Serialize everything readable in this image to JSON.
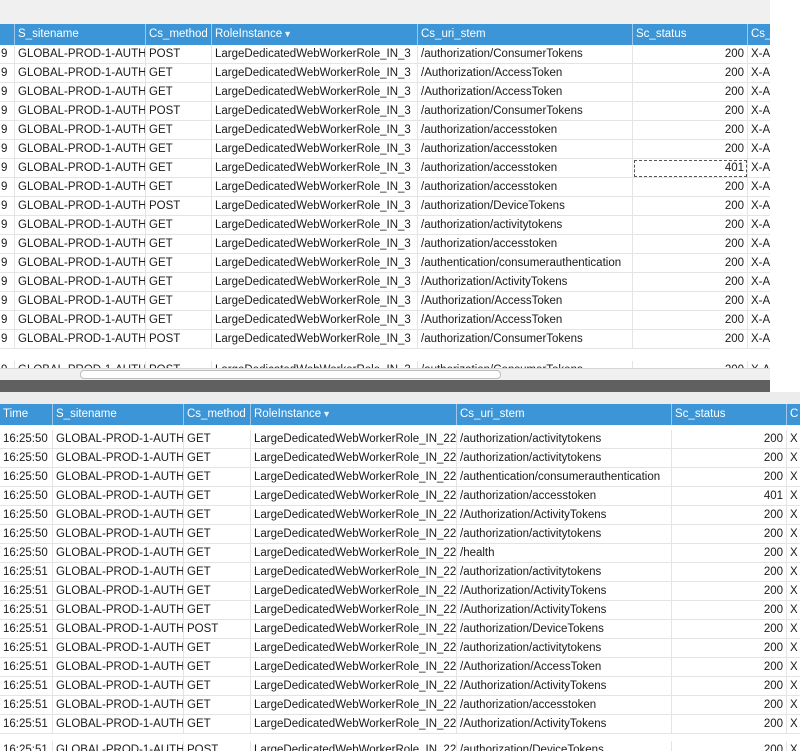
{
  "top_grid": {
    "columns": [
      "S_sitename",
      "Cs_method",
      "RoleInstance",
      "Cs_uri_stem",
      "Sc_status",
      "Cs_"
    ],
    "left_stub": "9",
    "right_stub": "X-A",
    "rows": [
      [
        "GLOBAL-PROD-1-AUTH",
        "POST",
        "LargeDedicatedWebWorkerRole_IN_3",
        "/authorization/ConsumerTokens",
        "200"
      ],
      [
        "GLOBAL-PROD-1-AUTH",
        "GET",
        "LargeDedicatedWebWorkerRole_IN_3",
        "/Authorization/AccessToken",
        "200"
      ],
      [
        "GLOBAL-PROD-1-AUTH",
        "GET",
        "LargeDedicatedWebWorkerRole_IN_3",
        "/Authorization/AccessToken",
        "200"
      ],
      [
        "GLOBAL-PROD-1-AUTH",
        "POST",
        "LargeDedicatedWebWorkerRole_IN_3",
        "/authorization/ConsumerTokens",
        "200"
      ],
      [
        "GLOBAL-PROD-1-AUTH",
        "GET",
        "LargeDedicatedWebWorkerRole_IN_3",
        "/authorization/accesstoken",
        "200"
      ],
      [
        "GLOBAL-PROD-1-AUTH",
        "GET",
        "LargeDedicatedWebWorkerRole_IN_3",
        "/authorization/accesstoken",
        "200"
      ],
      [
        "GLOBAL-PROD-1-AUTH",
        "GET",
        "LargeDedicatedWebWorkerRole_IN_3",
        "/authorization/accesstoken",
        "401"
      ],
      [
        "GLOBAL-PROD-1-AUTH",
        "GET",
        "LargeDedicatedWebWorkerRole_IN_3",
        "/authorization/accesstoken",
        "200"
      ],
      [
        "GLOBAL-PROD-1-AUTH",
        "POST",
        "LargeDedicatedWebWorkerRole_IN_3",
        "/authorization/DeviceTokens",
        "200"
      ],
      [
        "GLOBAL-PROD-1-AUTH",
        "GET",
        "LargeDedicatedWebWorkerRole_IN_3",
        "/authorization/activitytokens",
        "200"
      ],
      [
        "GLOBAL-PROD-1-AUTH",
        "GET",
        "LargeDedicatedWebWorkerRole_IN_3",
        "/authorization/accesstoken",
        "200"
      ],
      [
        "GLOBAL-PROD-1-AUTH",
        "GET",
        "LargeDedicatedWebWorkerRole_IN_3",
        "/authentication/consumerauthentication",
        "200"
      ],
      [
        "GLOBAL-PROD-1-AUTH",
        "GET",
        "LargeDedicatedWebWorkerRole_IN_3",
        "/Authorization/ActivityTokens",
        "200"
      ],
      [
        "GLOBAL-PROD-1-AUTH",
        "GET",
        "LargeDedicatedWebWorkerRole_IN_3",
        "/Authorization/AccessToken",
        "200"
      ],
      [
        "GLOBAL-PROD-1-AUTH",
        "GET",
        "LargeDedicatedWebWorkerRole_IN_3",
        "/Authorization/AccessToken",
        "200"
      ],
      [
        "GLOBAL-PROD-1-AUTH",
        "POST",
        "LargeDedicatedWebWorkerRole_IN_3",
        "/authorization/ConsumerTokens",
        "200"
      ]
    ],
    "partial_row": [
      "GLOBAL-PROD-1-AUTH",
      "POST",
      "LargeDedicatedWebWorkerRole_IN_3",
      "/authorization/ConsumerTokens",
      "200"
    ]
  },
  "bottom_grid": {
    "columns": [
      "Time",
      "S_sitename",
      "Cs_method",
      "RoleInstance",
      "Cs_uri_stem",
      "Sc_status",
      "C"
    ],
    "right_stub": "X",
    "rows": [
      [
        "16:25:50",
        "GLOBAL-PROD-1-AUTH",
        "GET",
        "LargeDedicatedWebWorkerRole_IN_22",
        "/authorization/activitytokens",
        "200"
      ],
      [
        "16:25:50",
        "GLOBAL-PROD-1-AUTH",
        "GET",
        "LargeDedicatedWebWorkerRole_IN_22",
        "/authorization/activitytokens",
        "200"
      ],
      [
        "16:25:50",
        "GLOBAL-PROD-1-AUTH",
        "GET",
        "LargeDedicatedWebWorkerRole_IN_22",
        "/authentication/consumerauthentication",
        "200"
      ],
      [
        "16:25:50",
        "GLOBAL-PROD-1-AUTH",
        "GET",
        "LargeDedicatedWebWorkerRole_IN_22",
        "/authorization/accesstoken",
        "401"
      ],
      [
        "16:25:50",
        "GLOBAL-PROD-1-AUTH",
        "GET",
        "LargeDedicatedWebWorkerRole_IN_22",
        "/Authorization/ActivityTokens",
        "200"
      ],
      [
        "16:25:50",
        "GLOBAL-PROD-1-AUTH",
        "GET",
        "LargeDedicatedWebWorkerRole_IN_22",
        "/authorization/activitytokens",
        "200"
      ],
      [
        "16:25:50",
        "GLOBAL-PROD-1-AUTH",
        "GET",
        "LargeDedicatedWebWorkerRole_IN_22",
        "/health",
        "200"
      ],
      [
        "16:25:51",
        "GLOBAL-PROD-1-AUTH",
        "GET",
        "LargeDedicatedWebWorkerRole_IN_22",
        "/authorization/activitytokens",
        "200"
      ],
      [
        "16:25:51",
        "GLOBAL-PROD-1-AUTH",
        "GET",
        "LargeDedicatedWebWorkerRole_IN_22",
        "/Authorization/ActivityTokens",
        "200"
      ],
      [
        "16:25:51",
        "GLOBAL-PROD-1-AUTH",
        "GET",
        "LargeDedicatedWebWorkerRole_IN_22",
        "/Authorization/ActivityTokens",
        "200"
      ],
      [
        "16:25:51",
        "GLOBAL-PROD-1-AUTH",
        "POST",
        "LargeDedicatedWebWorkerRole_IN_22",
        "/authorization/DeviceTokens",
        "200"
      ],
      [
        "16:25:51",
        "GLOBAL-PROD-1-AUTH",
        "GET",
        "LargeDedicatedWebWorkerRole_IN_22",
        "/authorization/activitytokens",
        "200"
      ],
      [
        "16:25:51",
        "GLOBAL-PROD-1-AUTH",
        "GET",
        "LargeDedicatedWebWorkerRole_IN_22",
        "/Authorization/AccessToken",
        "200"
      ],
      [
        "16:25:51",
        "GLOBAL-PROD-1-AUTH",
        "GET",
        "LargeDedicatedWebWorkerRole_IN_22",
        "/Authorization/ActivityTokens",
        "200"
      ],
      [
        "16:25:51",
        "GLOBAL-PROD-1-AUTH",
        "GET",
        "LargeDedicatedWebWorkerRole_IN_22",
        "/authorization/accesstoken",
        "200"
      ],
      [
        "16:25:51",
        "GLOBAL-PROD-1-AUTH",
        "GET",
        "LargeDedicatedWebWorkerRole_IN_22",
        "/Authorization/ActivityTokens",
        "200"
      ]
    ],
    "partial_row": [
      "16:25:51",
      "GLOBAL-PROD-1-AUTH",
      "POST",
      "LargeDedicatedWebWorkerRole_IN_22",
      "/authorization/DeviceTokens",
      "200"
    ]
  },
  "colors": {
    "header_bg": "#3c95d6",
    "header_text": "#ffffff",
    "focus_outline": "#555555"
  },
  "icons": {
    "filter": "filter-funnel-icon"
  }
}
